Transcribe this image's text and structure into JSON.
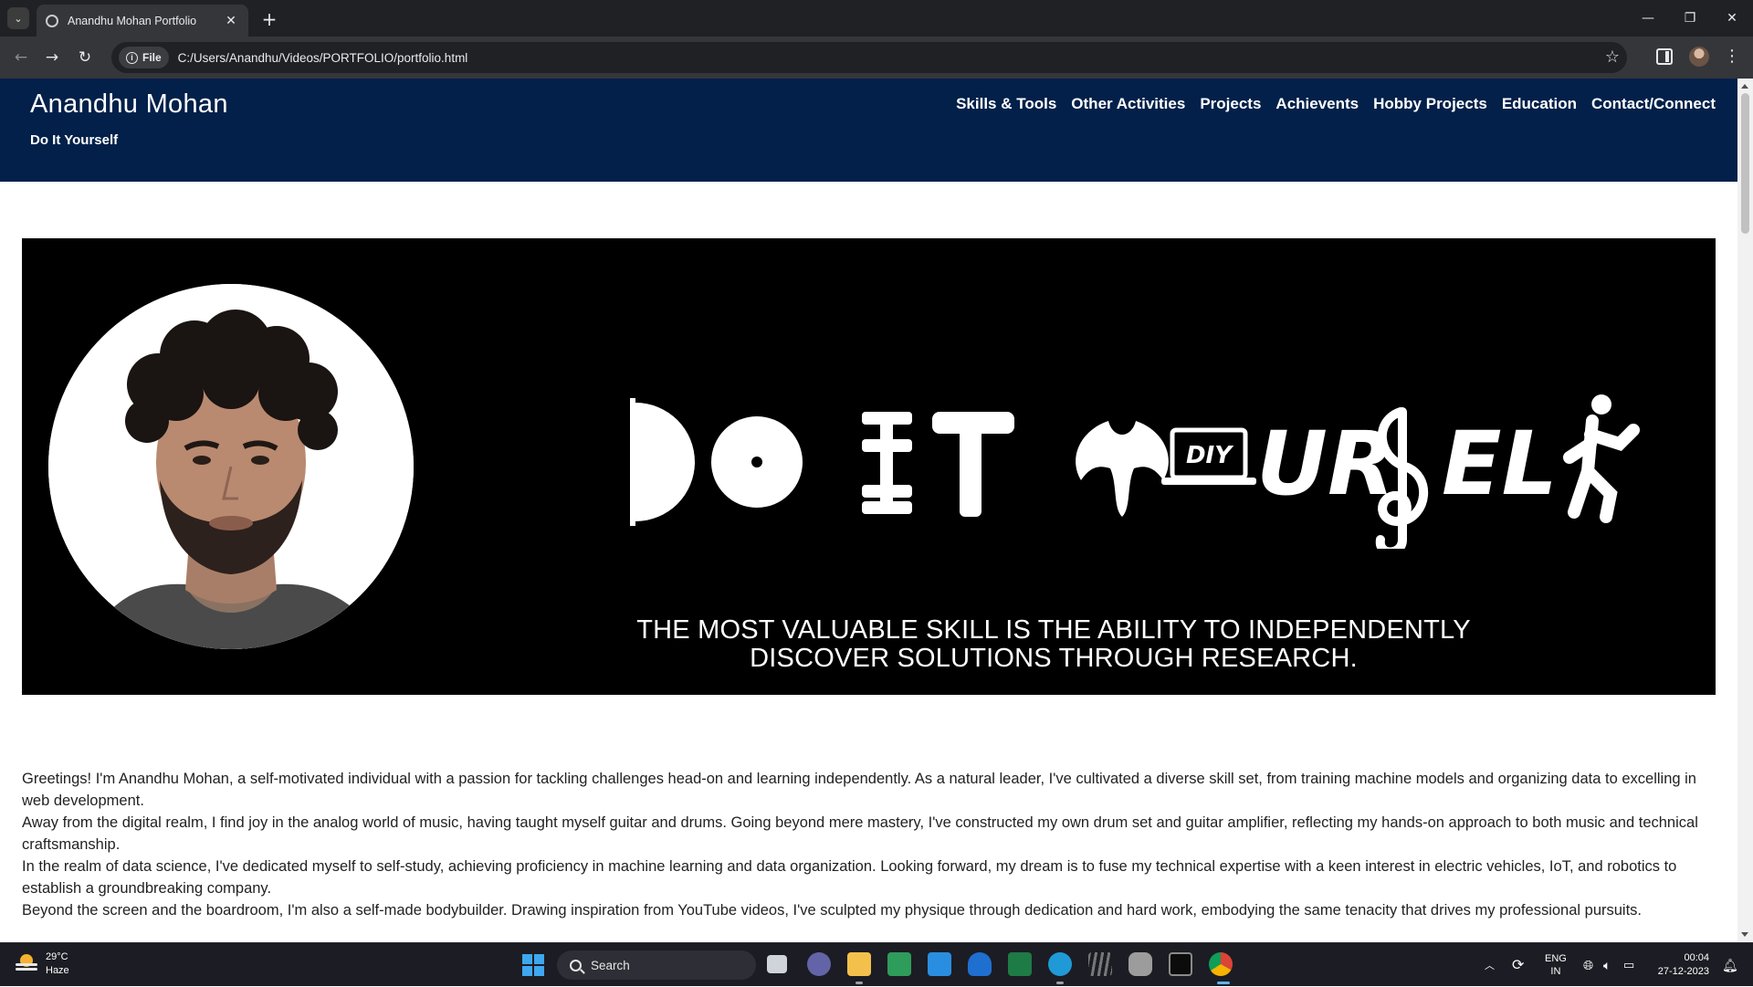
{
  "browser": {
    "tab_title": "Anandhu Mohan Portfolio",
    "url_scheme_label": "File",
    "url": "C:/Users/Anandhu/Videos/PORTFOLIO/portfolio.html"
  },
  "site": {
    "name": "Anandhu Mohan",
    "tagline": "Do It Yourself",
    "nav": [
      "Skills & Tools",
      "Other Activities",
      "Projects",
      "Achievents",
      "Hobby Projects",
      "Education",
      "Contact/Connect"
    ]
  },
  "banner": {
    "hero_text": "DO IT YOURSELF",
    "hero_badge": "DIY",
    "quote_line1": "THE MOST VALUABLE SKILL IS THE ABILITY TO INDEPENDENTLY",
    "quote_line2": "DISCOVER SOLUTIONS THROUGH RESEARCH."
  },
  "about": [
    "Greetings! I'm Anandhu Mohan, a self-motivated individual with a passion for tackling challenges head-on and learning independently. As a natural leader, I've cultivated a diverse skill set, from training machine models and organizing data to excelling in web development.",
    "Away from the digital realm, I find joy in the analog world of music, having taught myself guitar and drums. Going beyond mere mastery, I've constructed my own drum set and guitar amplifier, reflecting my hands-on approach to both music and technical craftsmanship.",
    "In the realm of data science, I've dedicated myself to self-study, achieving proficiency in machine learning and data organization. Looking forward, my dream is to fuse my technical expertise with a keen interest in electric vehicles, IoT, and robotics to establish a groundbreaking company.",
    "Beyond the screen and the boardroom, I'm also a self-made bodybuilder. Drawing inspiration from YouTube videos, I've sculpted my physique through dedication and hard work, embodying the same tenacity that drives my professional pursuits."
  ],
  "taskbar": {
    "temperature": "29°C",
    "weather": "Haze",
    "search_label": "Search",
    "language_line1": "ENG",
    "language_line2": "IN",
    "time": "00:04",
    "date": "27-12-2023"
  },
  "colors": {
    "header_bg": "#022049",
    "banner_bg": "#000000"
  }
}
